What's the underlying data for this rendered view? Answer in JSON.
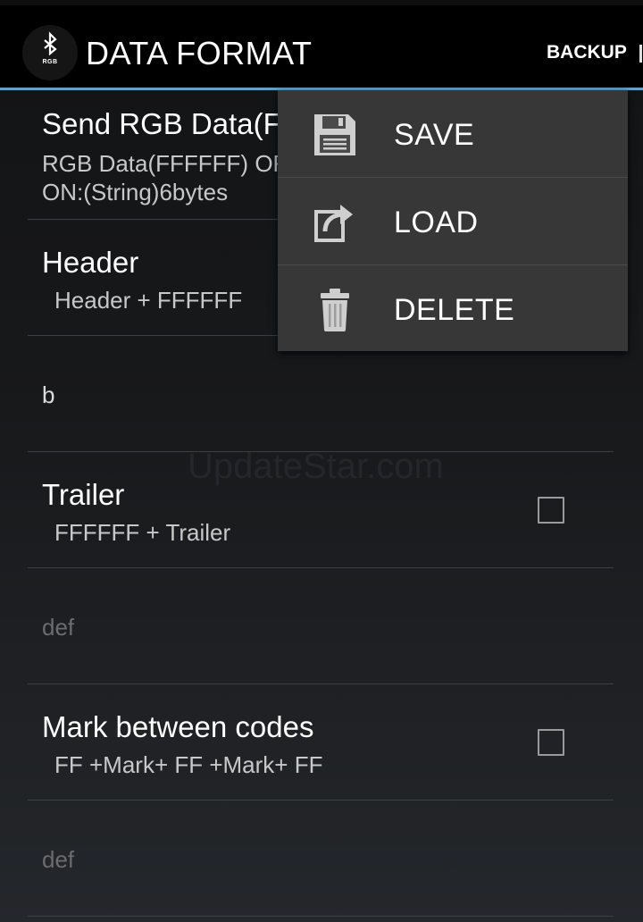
{
  "actionbar": {
    "app_icon_text": "RGB",
    "title": "DATA FORMAT",
    "backup_label": "BACKUP"
  },
  "preferences": {
    "send_rgb": {
      "title": "Send RGB Data(F",
      "summary_line1": "RGB Data(FFFFFF) OF",
      "summary_line2": "ON:(String)6bytes"
    },
    "header": {
      "title": "Header",
      "summary": "Header + FFFFFF",
      "value": "b"
    },
    "trailer": {
      "title": "Trailer",
      "summary": "FFFFFF + Trailer",
      "value": "def",
      "checked": false
    },
    "mark": {
      "title": "Mark between codes",
      "summary": "FF +Mark+ FF +Mark+ FF",
      "value": "def",
      "checked": false
    }
  },
  "watermark": "UpdateStar.com",
  "popup_menu": {
    "items": [
      {
        "label": "SAVE",
        "icon": "save-icon"
      },
      {
        "label": "LOAD",
        "icon": "load-icon"
      },
      {
        "label": "DELETE",
        "icon": "trash-icon"
      }
    ]
  },
  "colors": {
    "action_bar": "#000000",
    "accent_underline": "#5fa4c6",
    "popup_background": "#373737"
  }
}
